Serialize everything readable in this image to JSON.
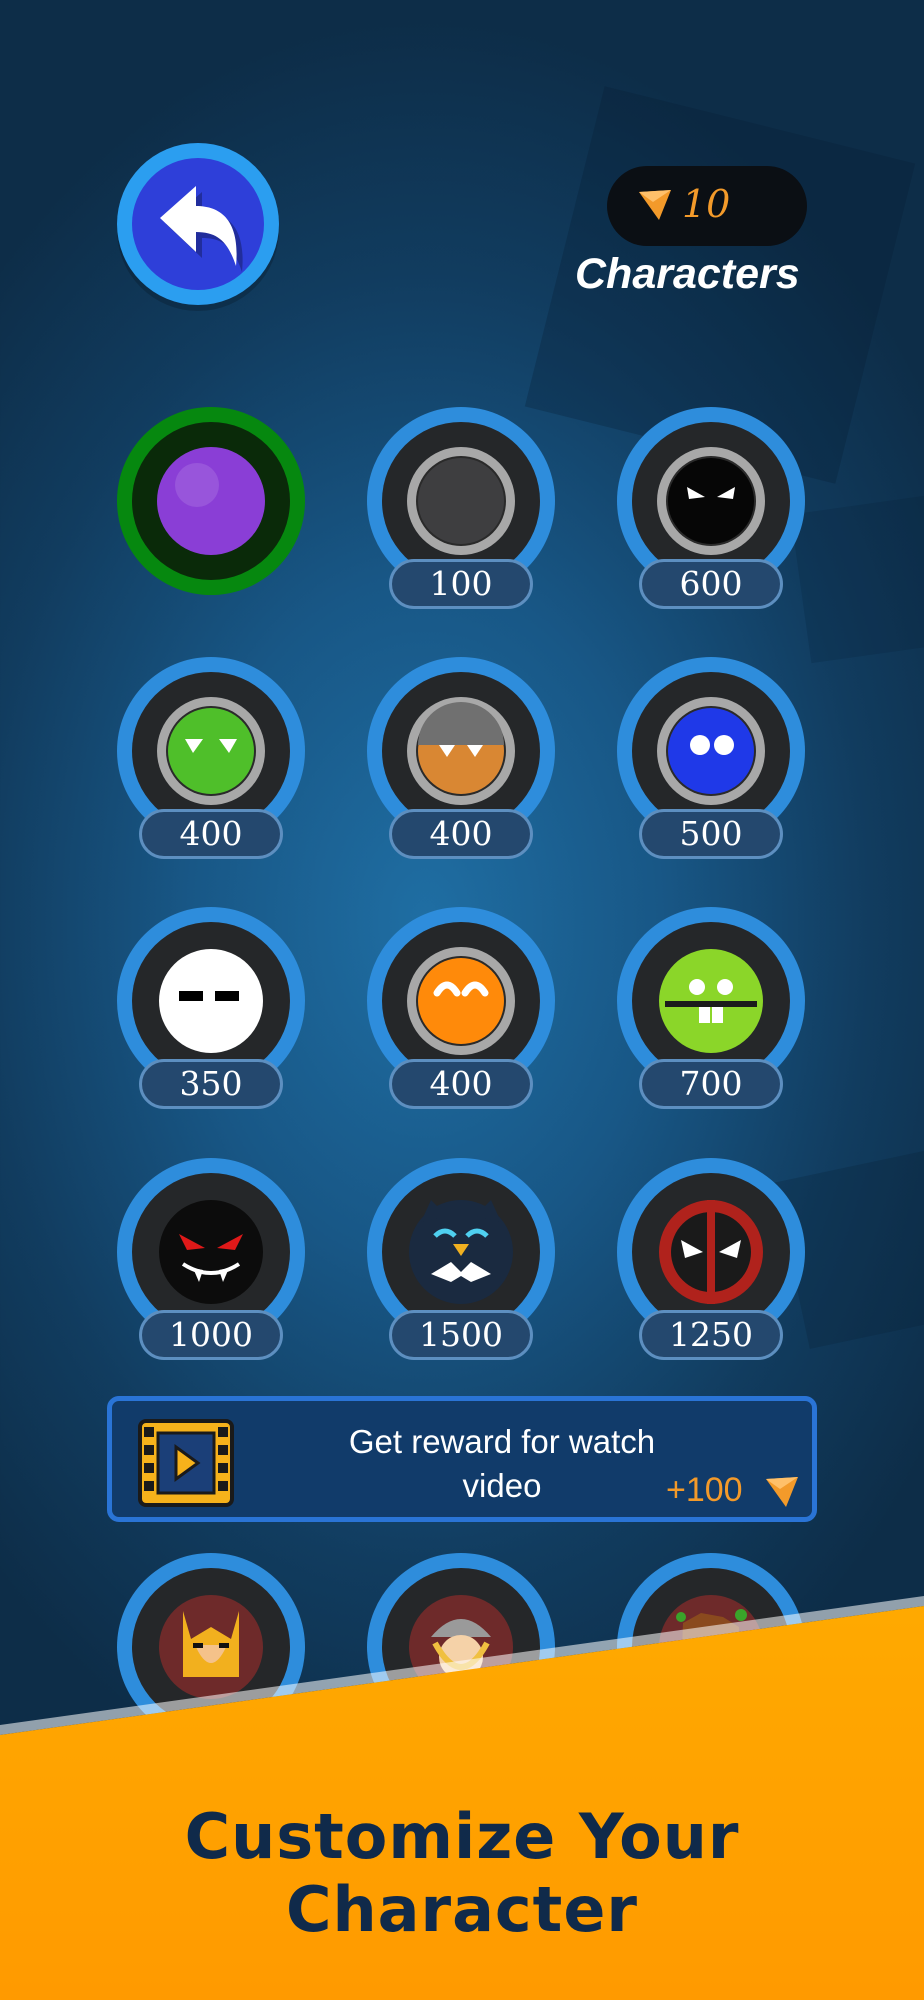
{
  "header": {
    "back_icon": "back-arrow-icon",
    "currency": {
      "icon": "triangle-gem-icon",
      "amount": "10"
    },
    "title": "Characters"
  },
  "characters": [
    {
      "name": "purple-ball",
      "price": "",
      "selected": true,
      "colors": {
        "body": "#8a3ed6"
      }
    },
    {
      "name": "gray-ball",
      "price": "100",
      "selected": false,
      "colors": {
        "body": "#3e3e40"
      }
    },
    {
      "name": "black-ninja-ball",
      "price": "600",
      "selected": false,
      "colors": {
        "body": "#060606"
      }
    },
    {
      "name": "green-angry-ball",
      "price": "400",
      "selected": false,
      "colors": {
        "body": "#4fbf2a"
      }
    },
    {
      "name": "orange-helmet-ball",
      "price": "400",
      "selected": false,
      "colors": {
        "body": "#d98733"
      }
    },
    {
      "name": "blue-eyes-ball",
      "price": "500",
      "selected": false,
      "colors": {
        "body": "#1f39e8"
      }
    },
    {
      "name": "white-sleepy-ball",
      "price": "350",
      "selected": false,
      "colors": {
        "body": "#ffffff"
      }
    },
    {
      "name": "orange-happy-ball",
      "price": "400",
      "selected": false,
      "colors": {
        "body": "#ff8a0a"
      }
    },
    {
      "name": "lime-teeth-ball",
      "price": "700",
      "selected": false,
      "colors": {
        "body": "#8bd629"
      }
    },
    {
      "name": "vampire-ball",
      "price": "1000",
      "selected": false,
      "colors": {
        "body": "#0c0c0c"
      }
    },
    {
      "name": "bat-owl-ball",
      "price": "1500",
      "selected": false,
      "colors": {
        "body": "#1a2a40"
      }
    },
    {
      "name": "masked-hero-ball",
      "price": "1250",
      "selected": false,
      "colors": {
        "body": "#b0221c"
      }
    },
    {
      "name": "clawed-hero-ball",
      "price": "",
      "selected": false,
      "colors": {
        "body": "#6e2a2a"
      }
    },
    {
      "name": "thunder-hero-ball",
      "price": "",
      "selected": false,
      "colors": {
        "body": "#6e2a2a"
      }
    },
    {
      "name": "tree-hero-ball",
      "price": "",
      "selected": false,
      "colors": {
        "body": "#6e2a2a"
      }
    }
  ],
  "reward_banner": {
    "icon": "film-play-icon",
    "line1": "Get reward for watch",
    "line2": "video",
    "bonus": "+100",
    "bonus_icon": "triangle-gem-icon"
  },
  "promo": {
    "text": "Customize Your Character"
  },
  "colors": {
    "ring_default": "#2e8ddc",
    "ring_selected": "#06880f",
    "accent_orange": "#f39a2a",
    "promo_yellow": "#ffd400"
  }
}
